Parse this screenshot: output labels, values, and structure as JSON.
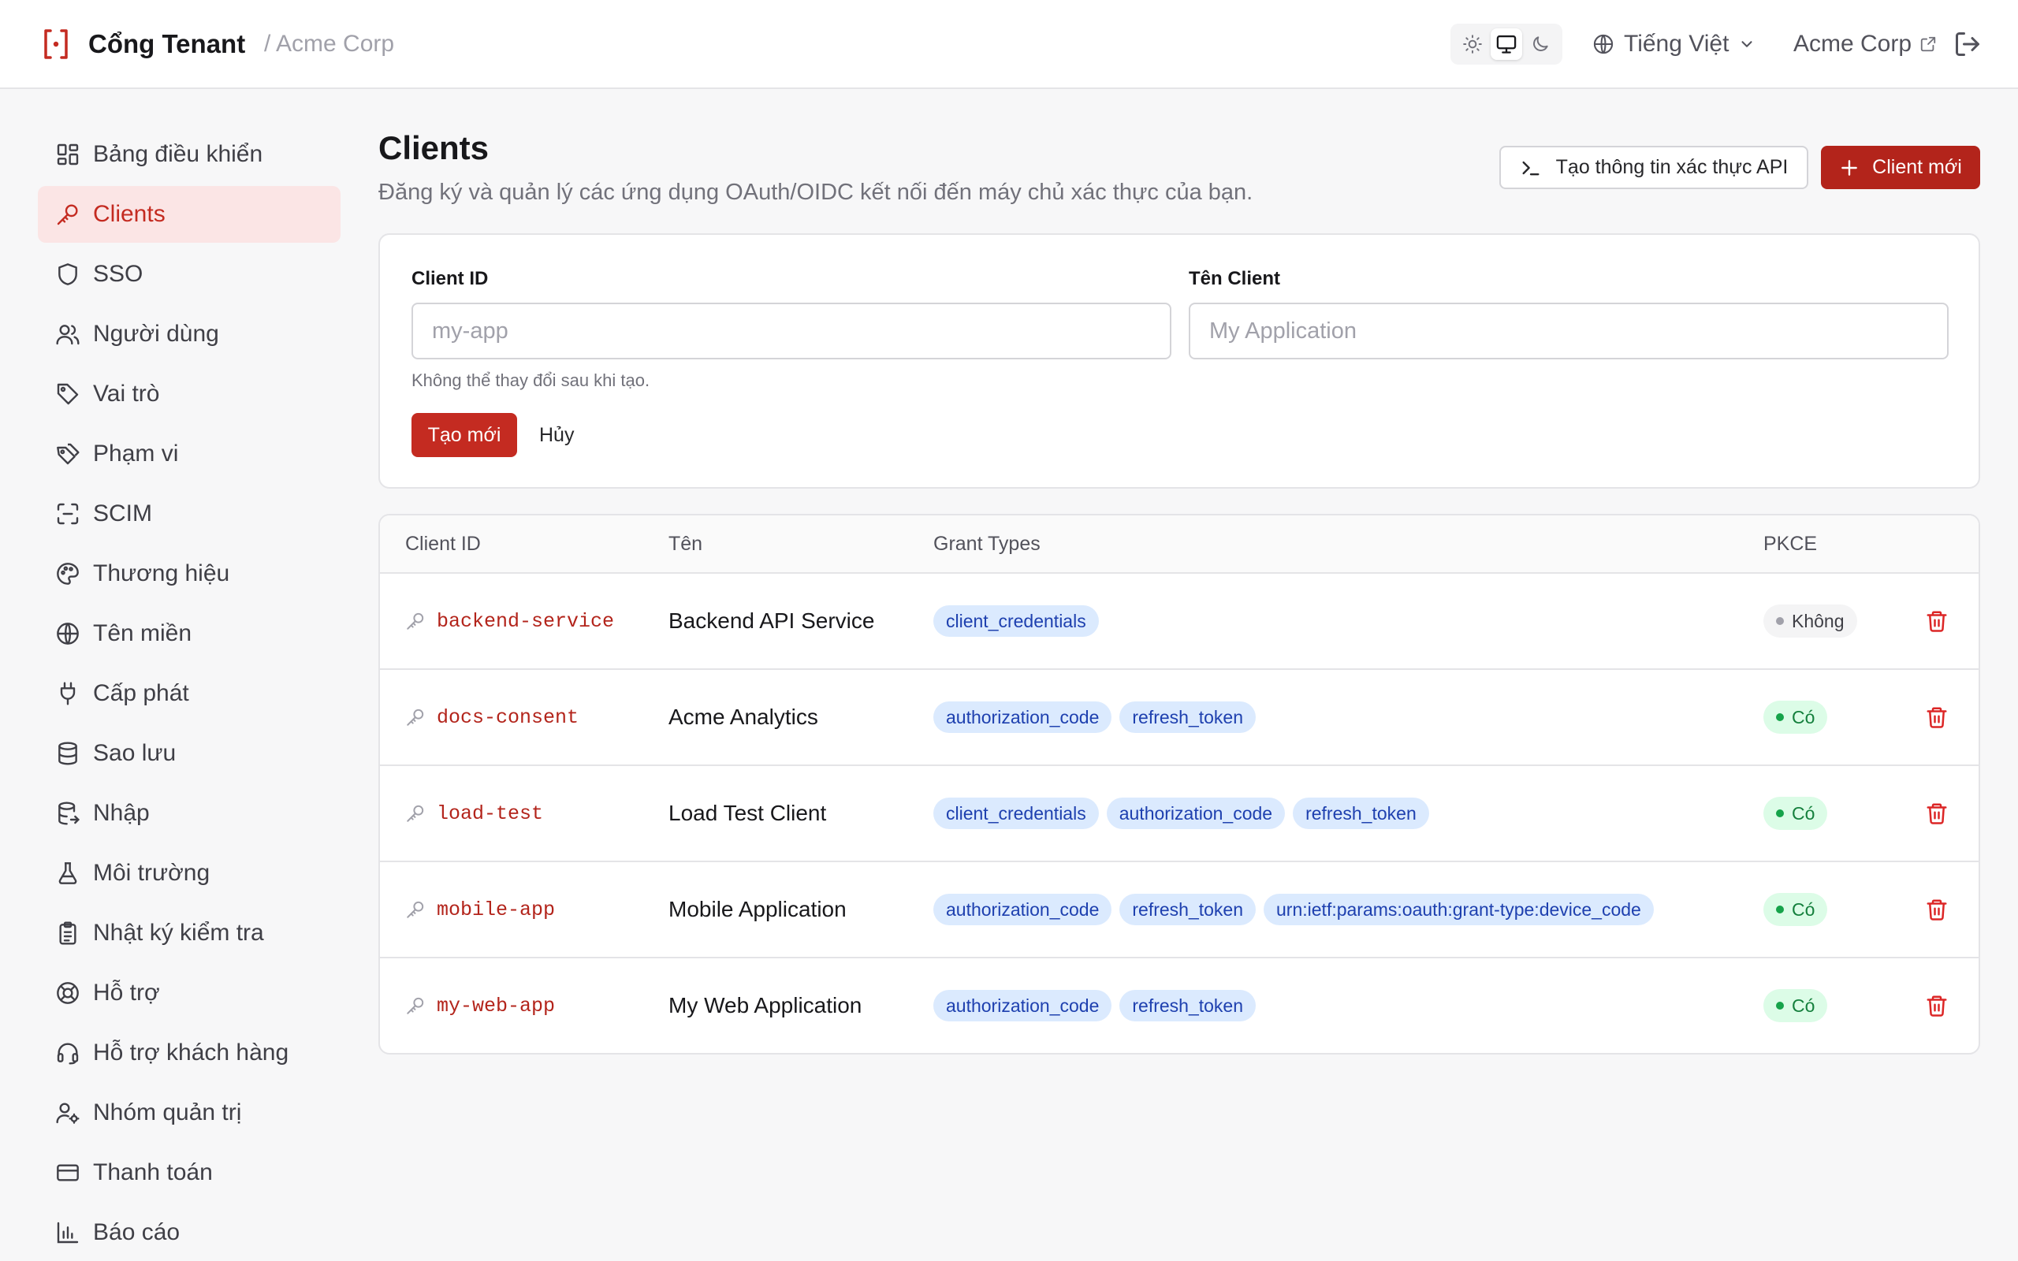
{
  "header": {
    "brand_name": "Cổng Tenant",
    "tenant_crumb": "/ Acme Corp",
    "language": "Tiếng Việt",
    "org_name": "Acme Corp",
    "theme_modes": [
      "light-icon",
      "monitor-icon",
      "moon-icon"
    ],
    "active_theme": "system"
  },
  "sidebar": {
    "items": [
      {
        "label": "Bảng điều khiển",
        "icon": "dashboard-icon"
      },
      {
        "label": "Clients",
        "icon": "key-icon",
        "active": true
      },
      {
        "label": "SSO",
        "icon": "shield-icon"
      },
      {
        "label": "Người dùng",
        "icon": "users-icon"
      },
      {
        "label": "Vai trò",
        "icon": "tag-icon"
      },
      {
        "label": "Phạm vi",
        "icon": "tags-icon"
      },
      {
        "label": "SCIM",
        "icon": "scan-icon"
      },
      {
        "label": "Thương hiệu",
        "icon": "palette-icon"
      },
      {
        "label": "Tên miền",
        "icon": "globe-icon"
      },
      {
        "label": "Cấp phát",
        "icon": "plug-icon"
      },
      {
        "label": "Sao lưu",
        "icon": "database-icon"
      },
      {
        "label": "Nhập",
        "icon": "database-import-icon"
      },
      {
        "label": "Môi trường",
        "icon": "flask-icon"
      },
      {
        "label": "Nhật ký kiểm tra",
        "icon": "clipboard-icon"
      },
      {
        "label": "Hỗ trợ",
        "icon": "lifebuoy-icon"
      },
      {
        "label": "Hỗ trợ khách hàng",
        "icon": "headset-icon"
      },
      {
        "label": "Nhóm quản trị",
        "icon": "user-cog-icon"
      },
      {
        "label": "Thanh toán",
        "icon": "credit-card-icon"
      },
      {
        "label": "Báo cáo",
        "icon": "bar-chart-icon"
      }
    ]
  },
  "main": {
    "title": "Clients",
    "subtitle": "Đăng ký và quản lý các ứng dụng OAuth/OIDC kết nối đến máy chủ xác thực của bạn.",
    "api_cred_button": "Tạo thông tin xác thực API",
    "new_client_button": "Client mới",
    "form": {
      "client_id_label": "Client ID",
      "client_id_placeholder": "my-app",
      "client_id_value": "",
      "client_name_label": "Tên Client",
      "client_name_placeholder": "My Application",
      "client_name_value": "",
      "hint": "Không thể thay đổi sau khi tạo.",
      "create_label": "Tạo mới",
      "cancel_label": "Hủy"
    },
    "table": {
      "columns": [
        "Client ID",
        "Tên",
        "Grant Types",
        "PKCE"
      ],
      "rows": [
        {
          "client_id": "backend-service",
          "name": "Backend API Service",
          "grants": [
            "client_credentials"
          ],
          "pkce": "Không",
          "pkce_enabled": false
        },
        {
          "client_id": "docs-consent",
          "name": "Acme Analytics",
          "grants": [
            "authorization_code",
            "refresh_token"
          ],
          "pkce": "Có",
          "pkce_enabled": true
        },
        {
          "client_id": "load-test",
          "name": "Load Test Client",
          "grants": [
            "client_credentials",
            "authorization_code",
            "refresh_token"
          ],
          "pkce": "Có",
          "pkce_enabled": true
        },
        {
          "client_id": "mobile-app",
          "name": "Mobile Application",
          "grants": [
            "authorization_code",
            "refresh_token",
            "urn:ietf:params:oauth:grant-type:device_code"
          ],
          "pkce": "Có",
          "pkce_enabled": true
        },
        {
          "client_id": "my-web-app",
          "name": "My Web Application",
          "grants": [
            "authorization_code",
            "refresh_token"
          ],
          "pkce": "Có",
          "pkce_enabled": true
        }
      ]
    }
  },
  "colors": {
    "accent": "#c42b21",
    "accent_dark": "#b3241b",
    "active_nav_bg": "#fbe5e5",
    "grant_badge_bg": "#dbeafe",
    "grant_badge_fg": "#1e40af",
    "pkce_yes_bg": "#dcfce7",
    "pkce_yes_fg": "#15803d"
  }
}
